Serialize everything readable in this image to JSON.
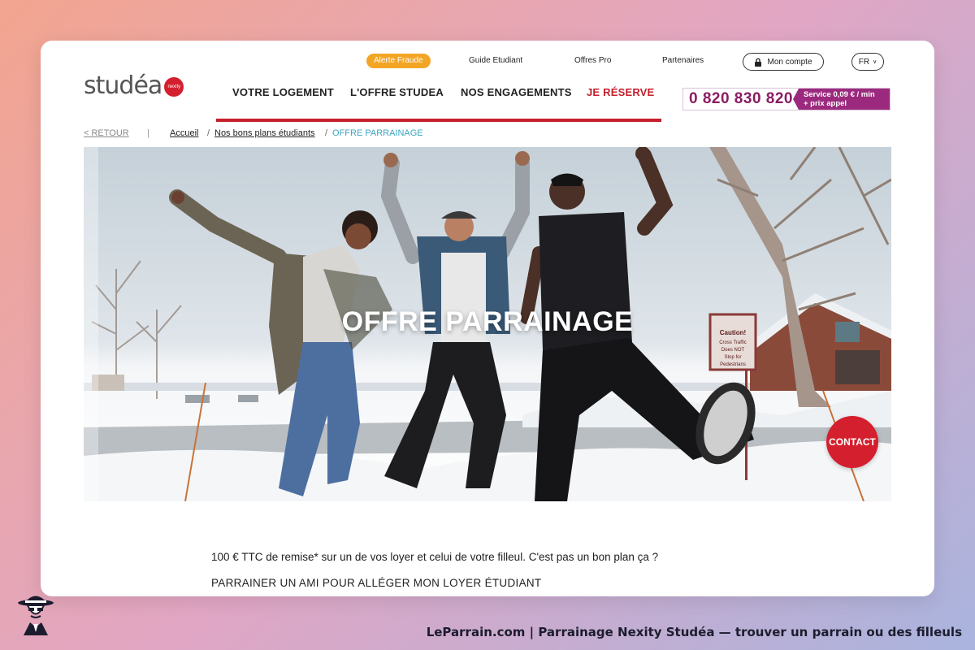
{
  "logo": {
    "text": "studéa",
    "badge": "nexity"
  },
  "topbar": {
    "alert": "Alerte Fraude",
    "guide": "Guide Etudiant",
    "offres_pro": "Offres Pro",
    "partenaires": "Partenaires",
    "account": "Mon compte",
    "lang": "FR"
  },
  "nav": {
    "items": [
      "VOTRE LOGEMENT",
      "L'OFFRE STUDEA",
      "NOS ENGAGEMENTS",
      "JE RÉSERVE"
    ]
  },
  "phone": {
    "number": "0 820 830 820",
    "tag_line1": "Service 0,09 € / min",
    "tag_line2": "+ prix appel"
  },
  "breadcrumb": {
    "back": "< RETOUR",
    "home": "Accueil",
    "bons_plans": "Nos bons plans étudiants",
    "current": "OFFRE PARRAINAGE"
  },
  "hero": {
    "title": "OFFRE PARRAINAGE",
    "sign_text": "Caution! Cross Traffic Does NOT Stop for Pedestrians"
  },
  "contact": "CONTACT",
  "intro": "100 € TTC de remise* sur un de vos loyer et celui de votre filleul. C'est pas un bon plan ça ?",
  "subhead": "PARRAINER UN AMI POUR ALLÉGER MON LOYER ÉTUDIANT",
  "footer": {
    "caption": "LeParrain.com | Parrainage Nexity Studéa — trouver un parrain ou des filleuls"
  },
  "colors": {
    "brand_red": "#c41f2b",
    "phone_purple": "#9b2a7e",
    "alert_orange": "#f3a525",
    "breadcrumb_blue": "#3aa6c4"
  }
}
